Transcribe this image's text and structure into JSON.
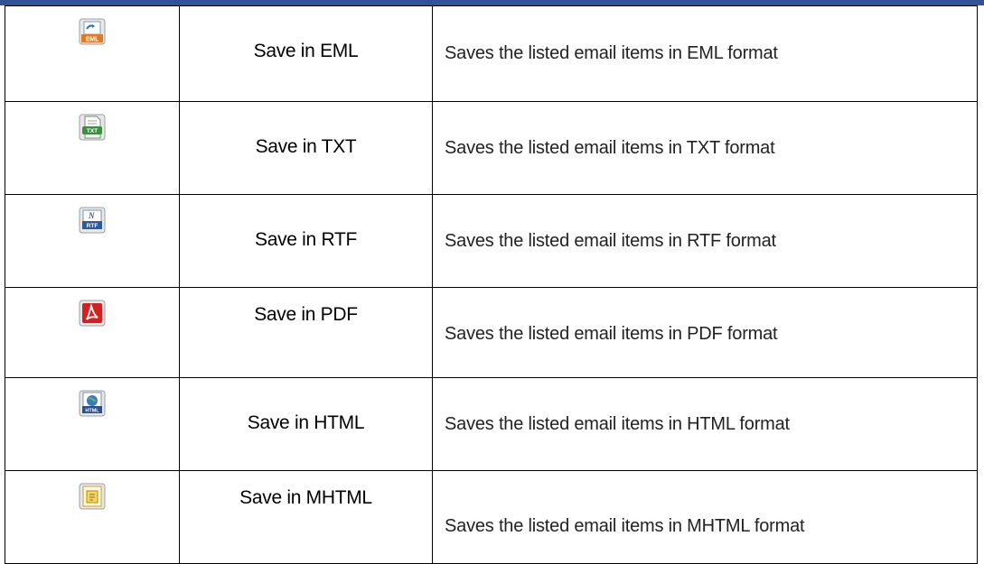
{
  "rows": [
    {
      "icon": "eml-file-icon",
      "name": "Save in EML",
      "description": "Saves the listed email items in EML format"
    },
    {
      "icon": "txt-file-icon",
      "name": "Save in TXT",
      "description": "Saves the listed email items in TXT format"
    },
    {
      "icon": "rtf-file-icon",
      "name": "Save in RTF",
      "description": "Saves the listed email items in RTF format"
    },
    {
      "icon": "pdf-file-icon",
      "name": "Save in PDF",
      "description": "Saves the listed email items in PDF format"
    },
    {
      "icon": "html-file-icon",
      "name": "Save in HTML",
      "description": "Saves the listed email items in HTML format"
    },
    {
      "icon": "mhtml-file-icon",
      "name": "Save in MHTML",
      "description": "Saves the listed email items in MHTML format"
    }
  ],
  "icon_labels": {
    "eml": "EML",
    "txt": "TXT",
    "rtf": "RTF",
    "html": "HTML"
  },
  "colors": {
    "header_rule": "#2f5496",
    "border": "#000000",
    "pdf_red": "#d32020"
  }
}
